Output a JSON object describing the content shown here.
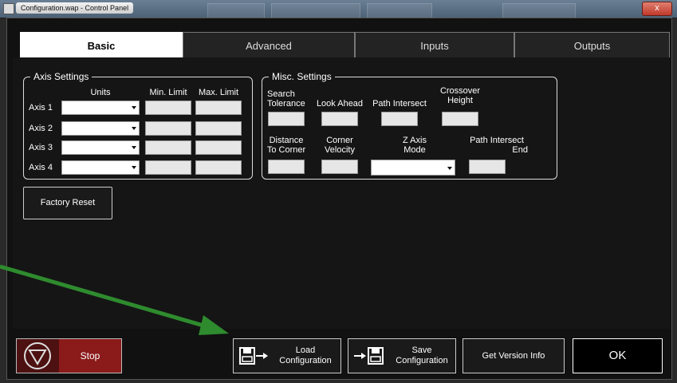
{
  "window": {
    "title": "Configuration.wap - Control Panel",
    "close_symbol": "x"
  },
  "tabs": [
    {
      "label": "Basic",
      "active": true
    },
    {
      "label": "Advanced",
      "active": false
    },
    {
      "label": "Inputs",
      "active": false
    },
    {
      "label": "Outputs",
      "active": false
    }
  ],
  "axis_settings": {
    "legend": "Axis Settings",
    "col_units": "Units",
    "col_min": "Min. Limit",
    "col_max": "Max. Limit",
    "axes": [
      "Axis 1",
      "Axis 2",
      "Axis 3",
      "Axis 4"
    ]
  },
  "misc_settings": {
    "legend": "Misc. Settings",
    "search_tolerance_1": "Search",
    "search_tolerance_2": "Tolerance",
    "look_ahead": "Look Ahead",
    "path_intersect": "Path Intersect",
    "crossover_1": "Crossover",
    "crossover_2": "Height",
    "distance_1": "Distance",
    "distance_2": "To Corner",
    "corner_1": "Corner",
    "corner_2": "Velocity",
    "zaxis_1": "Z Axis",
    "zaxis_2": "Mode",
    "pie_1": "Path Intersect",
    "pie_2": "End"
  },
  "factory_reset": "Factory Reset",
  "bottom": {
    "stop": "Stop",
    "load_1": "Load",
    "load_2": "Configuration",
    "save_1": "Save",
    "save_2": "Configuration",
    "version": "Get Version Info",
    "ok": "OK"
  },
  "colors": {
    "annotation_arrow": "#2e8b2e",
    "stop_red": "#8b1a1a",
    "active_tab": "#ffffff"
  },
  "icons": [
    "stop-icon",
    "load-disk-icon",
    "save-disk-icon",
    "annotation-arrow"
  ]
}
